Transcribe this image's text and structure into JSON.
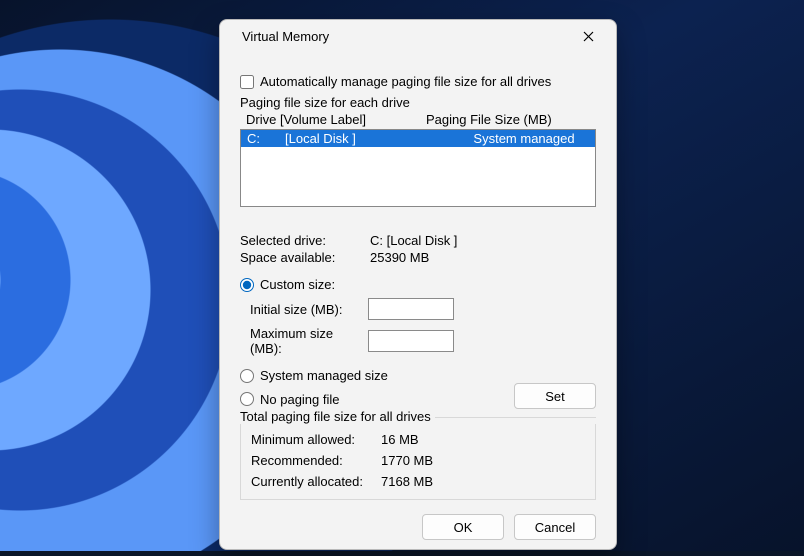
{
  "window": {
    "title": "Virtual Memory"
  },
  "auto_manage": {
    "label": "Automatically manage paging file size for all drives",
    "checked": false
  },
  "drive_section": {
    "group_label": "Paging file size for each drive",
    "header_drive": "Drive  [Volume Label]",
    "header_size": "Paging File Size (MB)",
    "rows": [
      {
        "drive": "C:",
        "label": "[Local Disk ]",
        "size": "System managed"
      }
    ]
  },
  "selected": {
    "drive_label": "Selected drive:",
    "drive_value": "C:  [Local Disk ]",
    "space_label": "Space available:",
    "space_value": "25390 MB"
  },
  "size_choice": {
    "custom_label": "Custom size:",
    "initial_label": "Initial size (MB):",
    "initial_value": "",
    "max_label": "Maximum size (MB):",
    "max_value": "",
    "system_label": "System managed size",
    "none_label": "No paging file",
    "selected": "custom",
    "set_button": "Set"
  },
  "totals": {
    "group_label": "Total paging file size for all drives",
    "min_label": "Minimum allowed:",
    "min_value": "16 MB",
    "rec_label": "Recommended:",
    "rec_value": "1770 MB",
    "cur_label": "Currently allocated:",
    "cur_value": "7168 MB"
  },
  "buttons": {
    "ok": "OK",
    "cancel": "Cancel"
  }
}
